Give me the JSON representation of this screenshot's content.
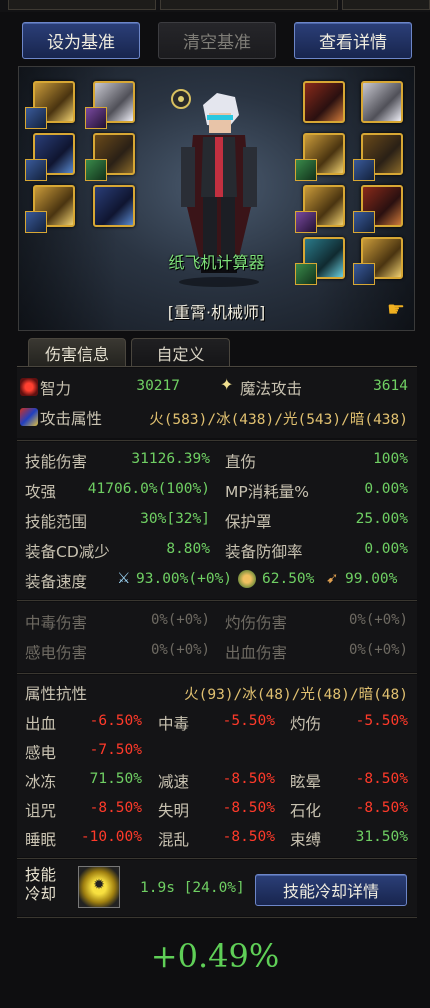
{
  "buttons": {
    "set_baseline": "设为基准",
    "clear_baseline": "清空基准",
    "view_details": "查看详情"
  },
  "character": {
    "name": "纸飞机计算器",
    "class": "[重霄·机械师]",
    "pointer_icon": "hand-pointer-icon"
  },
  "tabs": {
    "damage_info": "伤害信息",
    "custom": "自定义"
  },
  "stats": {
    "intelligence_label": "智力",
    "intelligence_value": "30217",
    "magic_attack_label": "魔法攻击",
    "magic_attack_value": "3614",
    "attack_attr_label": "攻击属性",
    "attack_attr_value": "火(583)/冰(438)/光(543)/暗(438)"
  },
  "damage": {
    "skill_damage_label": "技能伤害",
    "skill_damage_value": "31126.39%",
    "direct_label": "直伤",
    "direct_value": "100%",
    "attack_boost_label": "攻强",
    "attack_boost_value": "41706.0%(100%)",
    "mp_cost_label": "MP消耗量%",
    "mp_cost_value": "0.00%",
    "skill_range_label": "技能范围",
    "skill_range_value": "30%[32%]",
    "shield_label": "保护罩",
    "shield_value": "25.00%",
    "cd_reduce_label": "装备CD减少",
    "cd_reduce_value": "8.80%",
    "def_rate_label": "装备防御率",
    "def_rate_value": "0.00%",
    "speed_label": "装备速度",
    "speed_attack_value": "93.00%(+0%)",
    "speed_cast_value": "62.50%",
    "speed_move_value": "99.00%"
  },
  "status_damage": {
    "poison_label": "中毒伤害",
    "poison_value": "0%(+0%)",
    "burn_label": "灼伤伤害",
    "burn_value": "0%(+0%)",
    "shock_label": "感电伤害",
    "shock_value": "0%(+0%)",
    "bleed_label": "出血伤害",
    "bleed_value": "0%(+0%)"
  },
  "resist": {
    "title": "属性抗性",
    "elements_value": "火(93)/冰(48)/光(48)/暗(48)",
    "rows": [
      [
        {
          "label": "出血",
          "value": "-6.50%"
        },
        {
          "label": "中毒",
          "value": "-5.50%"
        },
        {
          "label": "灼伤",
          "value": "-5.50%"
        }
      ],
      [
        {
          "label": "感电",
          "value": "-7.50%"
        }
      ],
      [
        {
          "label": "冰冻",
          "value": "71.50%"
        },
        {
          "label": "减速",
          "value": "-8.50%"
        },
        {
          "label": "眩晕",
          "value": "-8.50%"
        }
      ],
      [
        {
          "label": "诅咒",
          "value": "-8.50%"
        },
        {
          "label": "失明",
          "value": "-8.50%"
        },
        {
          "label": "石化",
          "value": "-8.50%"
        }
      ],
      [
        {
          "label": "睡眠",
          "value": "-10.00%"
        },
        {
          "label": "混乱",
          "value": "-8.50%"
        },
        {
          "label": "束缚",
          "value": "31.50%"
        }
      ]
    ]
  },
  "cooldown": {
    "label_line1": "技能",
    "label_line2": "冷却",
    "value": "1.9s [24.0%]",
    "details_button": "技能冷却详情"
  },
  "result": {
    "value": "+0.49%"
  },
  "colors": {
    "positive": "#6fcf63",
    "negative": "#ff3a2a",
    "accent_blue": "#2b3f78",
    "item_border": "#d7a734"
  }
}
